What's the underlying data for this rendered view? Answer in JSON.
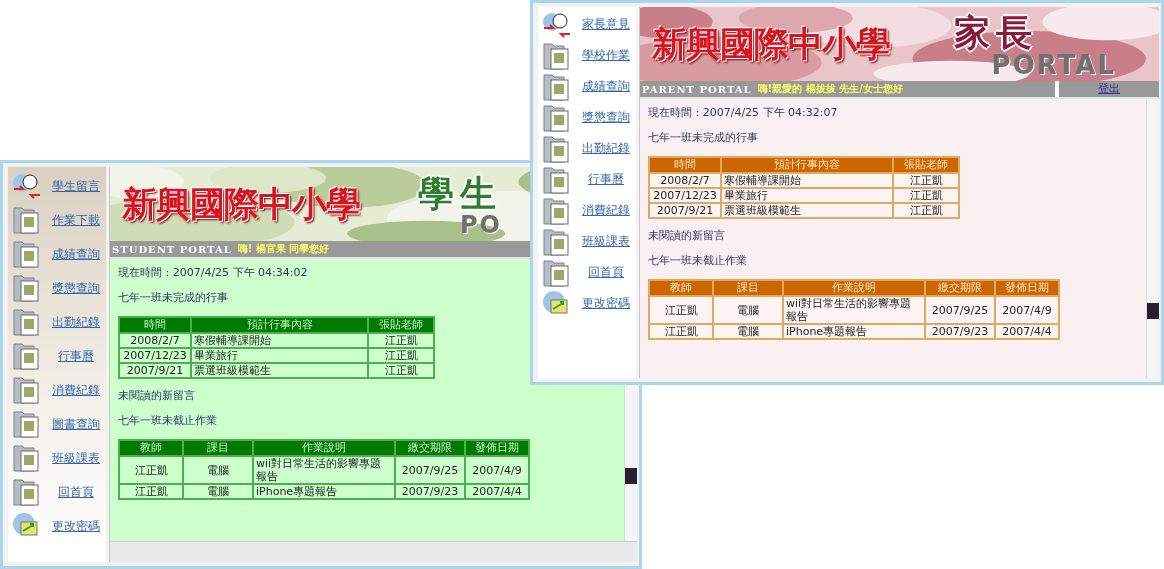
{
  "windows": [
    {
      "kind": "student",
      "sidebar": {
        "items": [
          {
            "label": "學生留言"
          },
          {
            "label": "作業下載"
          },
          {
            "label": "成績查詢"
          },
          {
            "label": "獎懲查詢"
          },
          {
            "label": "出勤紀錄"
          },
          {
            "label": "行事曆"
          },
          {
            "label": "消費紀錄"
          },
          {
            "label": "圖書查詢"
          },
          {
            "label": "班級課表"
          },
          {
            "label": "回首頁"
          },
          {
            "label": "更改密碼"
          }
        ]
      },
      "banner": {
        "school": "新興國際中小學",
        "role": "學生",
        "portal": "PO"
      },
      "greeting_bar": {
        "portal": "STUDENT PORTAL",
        "greeting": "嗨! 楊官果 同學您好"
      },
      "content": {
        "current_time": "現在時間 : 2007/4/25 下午 04:34:02",
        "events_heading": "七年一班未完成的行事",
        "events_table": {
          "columns": [
            "時間",
            "預計行事內容",
            "張貼老師"
          ],
          "rows": [
            [
              "2008/2/7",
              "寒假輔導課開始",
              "江正凱"
            ],
            [
              "2007/12/23",
              "畢業旅行",
              "江正凱"
            ],
            [
              "2007/9/21",
              "票選班級模範生",
              "江正凱"
            ]
          ]
        },
        "messages_heading": "未閱讀的新留言",
        "homework_heading": "七年一班未截止作業",
        "homework_table": {
          "columns": [
            "教師",
            "課目",
            "作業說明",
            "繳交期限",
            "發佈日期"
          ],
          "rows": [
            [
              "江正凱",
              "電腦",
              "wii對日常生活的影響專題報告",
              "2007/9/25",
              "2007/4/9"
            ],
            [
              "江正凱",
              "電腦",
              "iPhone專題報告",
              "2007/9/23",
              "2007/4/4"
            ]
          ]
        }
      }
    },
    {
      "kind": "parent",
      "sidebar": {
        "items": [
          {
            "label": "家長意見"
          },
          {
            "label": "學校作業"
          },
          {
            "label": "成績查詢"
          },
          {
            "label": "獎懲查詢"
          },
          {
            "label": "出勤紀錄"
          },
          {
            "label": "行事曆"
          },
          {
            "label": "消費紀錄"
          },
          {
            "label": "班級課表"
          },
          {
            "label": "回首頁"
          },
          {
            "label": "更改密碼"
          }
        ]
      },
      "banner": {
        "school": "新興國際中小學",
        "role": "家長",
        "portal": "PORTAL"
      },
      "greeting_bar": {
        "portal": "PARENT PORTAL",
        "greeting": "嗨!親愛的 楊拔拔 先生/女士您好",
        "logout": "登出"
      },
      "content": {
        "current_time": "現在時間 : 2007/4/25 下午 04:32:07",
        "events_heading": "七年一班未完成的行事",
        "events_table": {
          "columns": [
            "時間",
            "預計行事內容",
            "張貼老師"
          ],
          "rows": [
            [
              "2008/2/7",
              "寒假輔導課開始",
              "江正凱"
            ],
            [
              "2007/12/23",
              "畢業旅行",
              "江正凱"
            ],
            [
              "2007/9/21",
              "票選班級模範生",
              "江正凱"
            ]
          ]
        },
        "messages_heading": "未閱讀的新留言",
        "homework_heading": "七年一班未截止作業",
        "homework_table": {
          "columns": [
            "教師",
            "課目",
            "作業說明",
            "繳交期限",
            "發佈日期"
          ],
          "rows": [
            [
              "江正凱",
              "電腦",
              "wii對日常生活的影響專題報告",
              "2007/9/25",
              "2007/4/9"
            ],
            [
              "江正凱",
              "電腦",
              "iPhone專題報告",
              "2007/9/23",
              "2007/4/4"
            ]
          ]
        }
      }
    }
  ]
}
